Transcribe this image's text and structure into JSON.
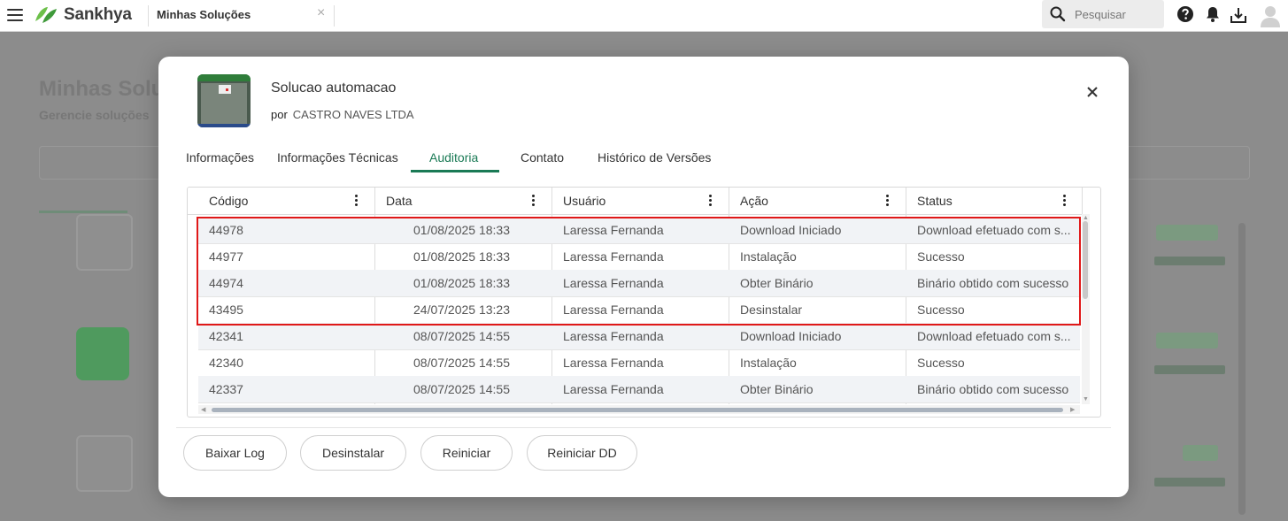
{
  "topbar": {
    "brand": "Sankhya",
    "app_tab": "Minhas Soluções",
    "app_tab_close": "×",
    "search_placeholder": "Pesquisar"
  },
  "background": {
    "title": "Minhas Solu",
    "subtitle": "Gerencie soluções"
  },
  "modal": {
    "solution_title": "Solucao automacao",
    "by_label": "por",
    "company": "CASTRO NAVES LTDA",
    "tabs": [
      {
        "label": "Informações"
      },
      {
        "label": "Informações Técnicas"
      },
      {
        "label": "Auditoria",
        "active": true
      },
      {
        "label": "Contato"
      },
      {
        "label": "Histórico de Versões"
      }
    ],
    "grid": {
      "columns": [
        "Código",
        "Data",
        "Usuário",
        "Ação",
        "Status"
      ],
      "rows": [
        [
          "44978",
          "01/08/2025 18:33",
          "Laressa Fernanda",
          "Download Iniciado",
          "Download efetuado com s..."
        ],
        [
          "44977",
          "01/08/2025 18:33",
          "Laressa Fernanda",
          "Instalação",
          "Sucesso"
        ],
        [
          "44974",
          "01/08/2025 18:33",
          "Laressa Fernanda",
          "Obter Binário",
          "Binário obtido com sucesso"
        ],
        [
          "43495",
          "24/07/2025 13:23",
          "Laressa Fernanda",
          "Desinstalar",
          "Sucesso"
        ],
        [
          "42341",
          "08/07/2025 14:55",
          "Laressa Fernanda",
          "Download Iniciado",
          "Download efetuado com s..."
        ],
        [
          "42340",
          "08/07/2025 14:55",
          "Laressa Fernanda",
          "Instalação",
          "Sucesso"
        ],
        [
          "42337",
          "08/07/2025 14:55",
          "Laressa Fernanda",
          "Obter Binário",
          "Binário obtido com sucesso"
        ]
      ],
      "highlight_color": "#e01818"
    },
    "buttons": [
      "Baixar Log",
      "Desinstalar",
      "Reiniciar",
      "Reiniciar DD"
    ]
  },
  "colors": {
    "accent": "#1a7a55",
    "brand_green": "#4caf50",
    "row_alt": "#f1f3f6"
  },
  "icons": {
    "menu": "hamburger-icon",
    "brand": "sankhya-leaf-icon",
    "search": "search-icon",
    "help": "help-icon",
    "notifications": "bell-icon",
    "download": "download-icon",
    "user": "user-avatar-icon",
    "close": "close-icon",
    "column_menu": "kebab-icon"
  }
}
